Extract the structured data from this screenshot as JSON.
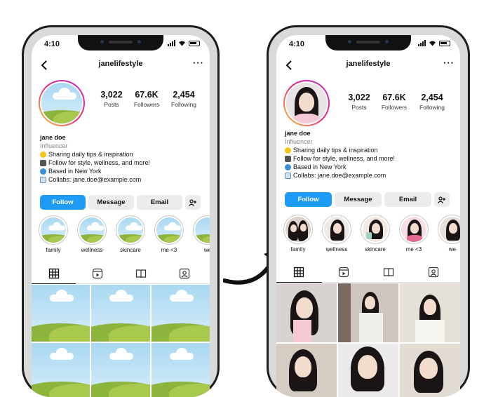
{
  "before": {
    "status_time": "4:10",
    "username": "janelifestyle",
    "stats": [
      {
        "num": "3,022",
        "label": "Posts"
      },
      {
        "num": "67.6K",
        "label": "Followers"
      },
      {
        "num": "2,454",
        "label": "Following"
      }
    ],
    "name": "jane doe",
    "category": "Influencer",
    "bio_lines": [
      "Sharing daily tips & inspiration",
      "Follow for style, wellness, and more!",
      "Based in New York",
      "Collabs: jane.doe@example.com"
    ],
    "buttons": {
      "follow": "Follow",
      "message": "Message",
      "email": "Email"
    },
    "highlights": [
      "family",
      "wellness",
      "skincare",
      "me <3",
      "we"
    ]
  },
  "after": {
    "status_time": "4:10",
    "username": "janelifestyle",
    "stats": [
      {
        "num": "3,022",
        "label": "Posts"
      },
      {
        "num": "67.6K",
        "label": "Followers"
      },
      {
        "num": "2,454",
        "label": "Following"
      }
    ],
    "name": "jane doe",
    "category": "Influencer",
    "bio_lines": [
      "Sharing daily tips & inspiration",
      "Follow for style, wellness, and more!",
      "Based in New York",
      "Collabs: jane.doe@example.com"
    ],
    "buttons": {
      "follow": "Follow",
      "message": "Message",
      "email": "Email"
    },
    "highlights": [
      "family",
      "wellness",
      "skincare",
      "me <3",
      "we"
    ]
  },
  "icons": {
    "back": "chevron-left-icon",
    "more": "more-dots-icon",
    "add_person": "add-person-icon",
    "grid_tab": "grid-icon",
    "reels_tab": "reels-icon",
    "guides_tab": "guides-icon",
    "tagged_tab": "tagged-icon"
  },
  "colors": {
    "follow_button": "#1e9af7",
    "story_ring_start": "#f9ce34",
    "story_ring_end": "#b82fd4",
    "phone_frame": "#1c1c1c"
  }
}
